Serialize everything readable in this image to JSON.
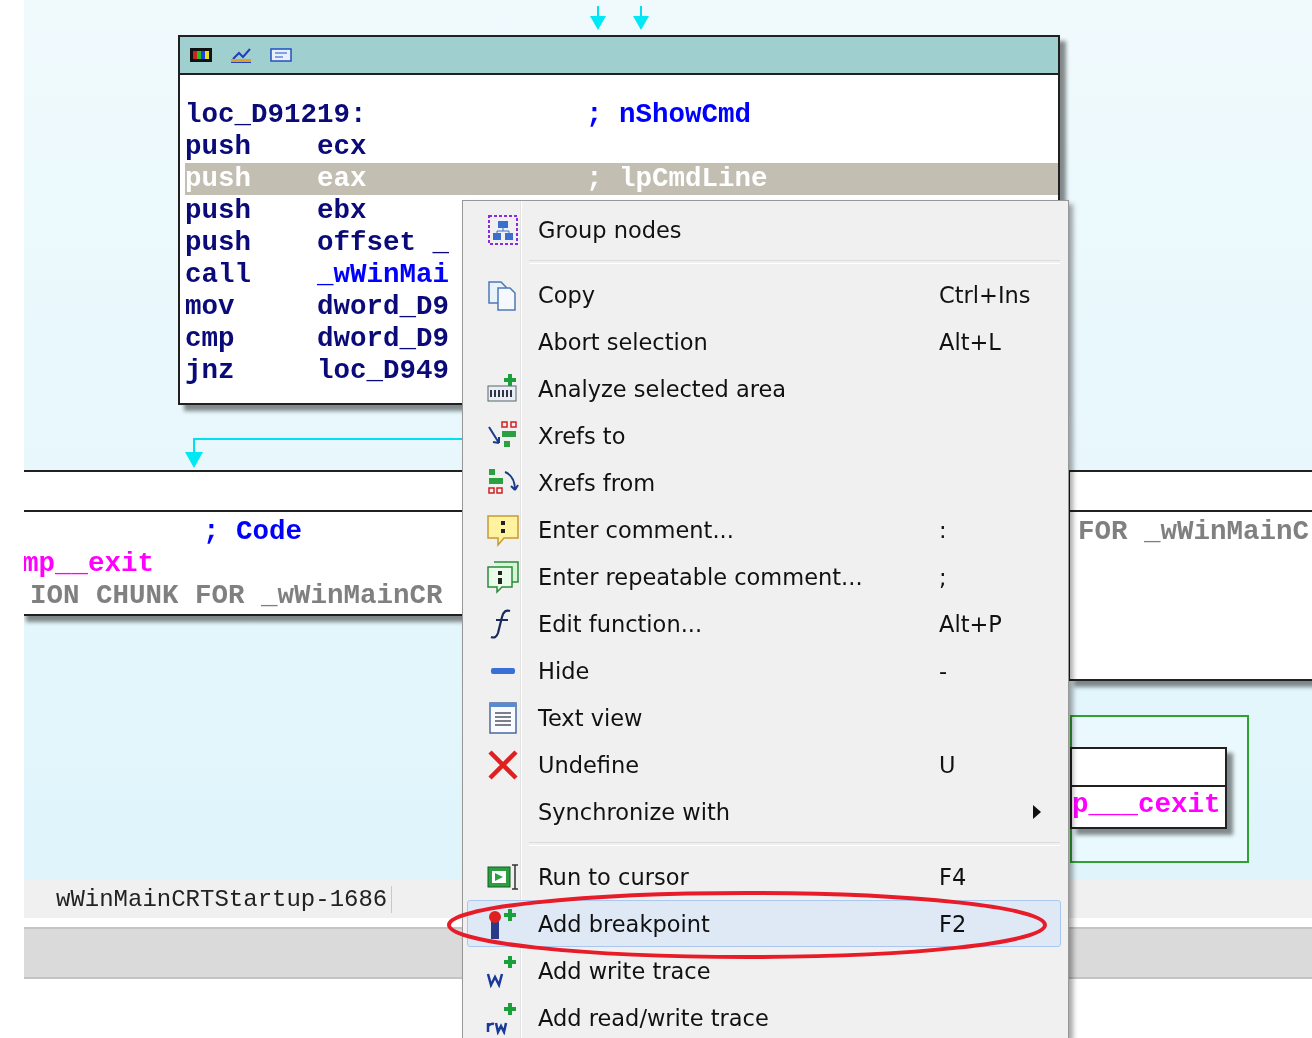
{
  "top_node": {
    "lines": [
      {
        "kind": "label",
        "label": "loc_D91219:",
        "comment": "; nShowCmd",
        "selected": false
      },
      {
        "kind": "instr",
        "mnemonic": "push",
        "operand": "ecx",
        "selected": false
      },
      {
        "kind": "instr",
        "mnemonic": "push",
        "operand": "eax",
        "comment": "; lpCmdLine",
        "selected": true
      },
      {
        "kind": "instr",
        "mnemonic": "push",
        "operand": "ebx",
        "selected": false
      },
      {
        "kind": "instr",
        "mnemonic": "push",
        "operand": "offset _",
        "selected": false
      },
      {
        "kind": "instr",
        "mnemonic": "call",
        "operand": "_wWinMai",
        "link": true,
        "selected": false
      },
      {
        "kind": "instr",
        "mnemonic": "mov",
        "operand": "dword_D9",
        "selected": false
      },
      {
        "kind": "instr",
        "mnemonic": "cmp",
        "operand": "dword_D9",
        "selected": false
      },
      {
        "kind": "instr",
        "mnemonic": "jnz",
        "operand": "loc_D949",
        "selected": false
      }
    ]
  },
  "left_node": {
    "lines": [
      {
        "kind": "comment",
        "text": "; Code"
      },
      {
        "kind": "name",
        "text": "mp__exit"
      },
      {
        "kind": "gray",
        "text": "ION CHUNK FOR _wWinMainCR"
      }
    ]
  },
  "right_node": {
    "lines": [
      {
        "kind": "gray",
        "text": "FOR _wWinMainC"
      }
    ]
  },
  "group_node": {
    "lines": [
      {
        "kind": "name",
        "text": "p___cexit"
      }
    ]
  },
  "status_bar": {
    "location": "wWinMainCRTStartup-1686"
  },
  "context_menu": {
    "items": [
      {
        "kind": "item",
        "label": "Group nodes",
        "selected": false,
        "submenu": false
      },
      {
        "kind": "separator"
      },
      {
        "kind": "item",
        "label": "Copy",
        "shortcut": "Ctrl+Ins",
        "selected": false,
        "submenu": false
      },
      {
        "kind": "item",
        "label": "Abort selection",
        "shortcut": "Alt+L",
        "selected": false,
        "submenu": false
      },
      {
        "kind": "item",
        "label": "Analyze selected area",
        "selected": false,
        "submenu": false
      },
      {
        "kind": "item",
        "label": "Xrefs to",
        "selected": false,
        "submenu": false
      },
      {
        "kind": "item",
        "label": "Xrefs from",
        "selected": false,
        "submenu": false
      },
      {
        "kind": "item",
        "label": "Enter comment...",
        "shortcut": ":",
        "selected": false,
        "submenu": false
      },
      {
        "kind": "item",
        "label": "Enter repeatable comment...",
        "shortcut": ";",
        "selected": false,
        "submenu": false
      },
      {
        "kind": "item",
        "label": "Edit function...",
        "shortcut": "Alt+P",
        "selected": false,
        "submenu": false
      },
      {
        "kind": "item",
        "label": "Hide",
        "shortcut": "-",
        "selected": false,
        "submenu": false
      },
      {
        "kind": "item",
        "label": "Text view",
        "selected": false,
        "submenu": false
      },
      {
        "kind": "item",
        "label": "Undefine",
        "shortcut": "U",
        "selected": false,
        "submenu": false
      },
      {
        "kind": "item",
        "label": "Synchronize with",
        "selected": false,
        "submenu": true
      },
      {
        "kind": "separator"
      },
      {
        "kind": "item",
        "label": "Run to cursor",
        "shortcut": "F4",
        "selected": false,
        "submenu": false
      },
      {
        "kind": "item",
        "label": "Add breakpoint",
        "shortcut": "F2",
        "selected": true,
        "submenu": false
      },
      {
        "kind": "item",
        "label": "Add write trace",
        "selected": false,
        "submenu": false
      },
      {
        "kind": "item",
        "label": "Add read/write trace",
        "selected": false,
        "submenu": false
      }
    ]
  }
}
